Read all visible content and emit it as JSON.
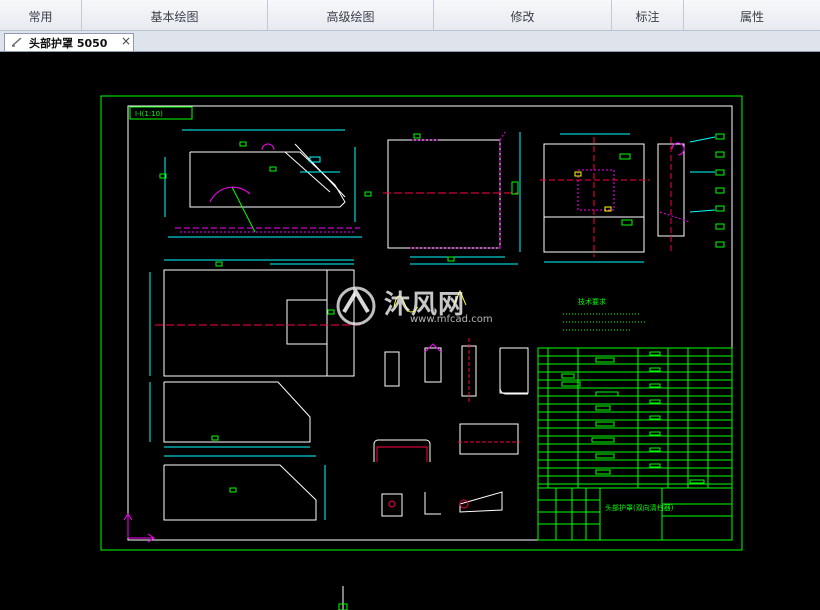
{
  "ribbon": {
    "tabs": [
      {
        "label": "常用"
      },
      {
        "label": "基本绘图"
      },
      {
        "label": "高级绘图"
      },
      {
        "label": "修改"
      },
      {
        "label": "标注"
      },
      {
        "label": "属性"
      }
    ]
  },
  "document_tab": {
    "title": "头部护罩 5050",
    "close_glyph": "×"
  },
  "drawing": {
    "title_block_title": "头部护罩(双向清扫器)",
    "section_label": "I-I(1:10)",
    "note_heading": "技术要求",
    "watermark": {
      "brand": "沐风网",
      "url": "www.mfcad.com"
    },
    "colors": {
      "background": "#000000",
      "frame": "#00ff00",
      "outline": "#ffffff",
      "dimension": "#00ffff",
      "centerline": "#ff0044",
      "hidden": "#ff00ff",
      "text": "#00ff00",
      "highlight": "#ffff00"
    }
  }
}
